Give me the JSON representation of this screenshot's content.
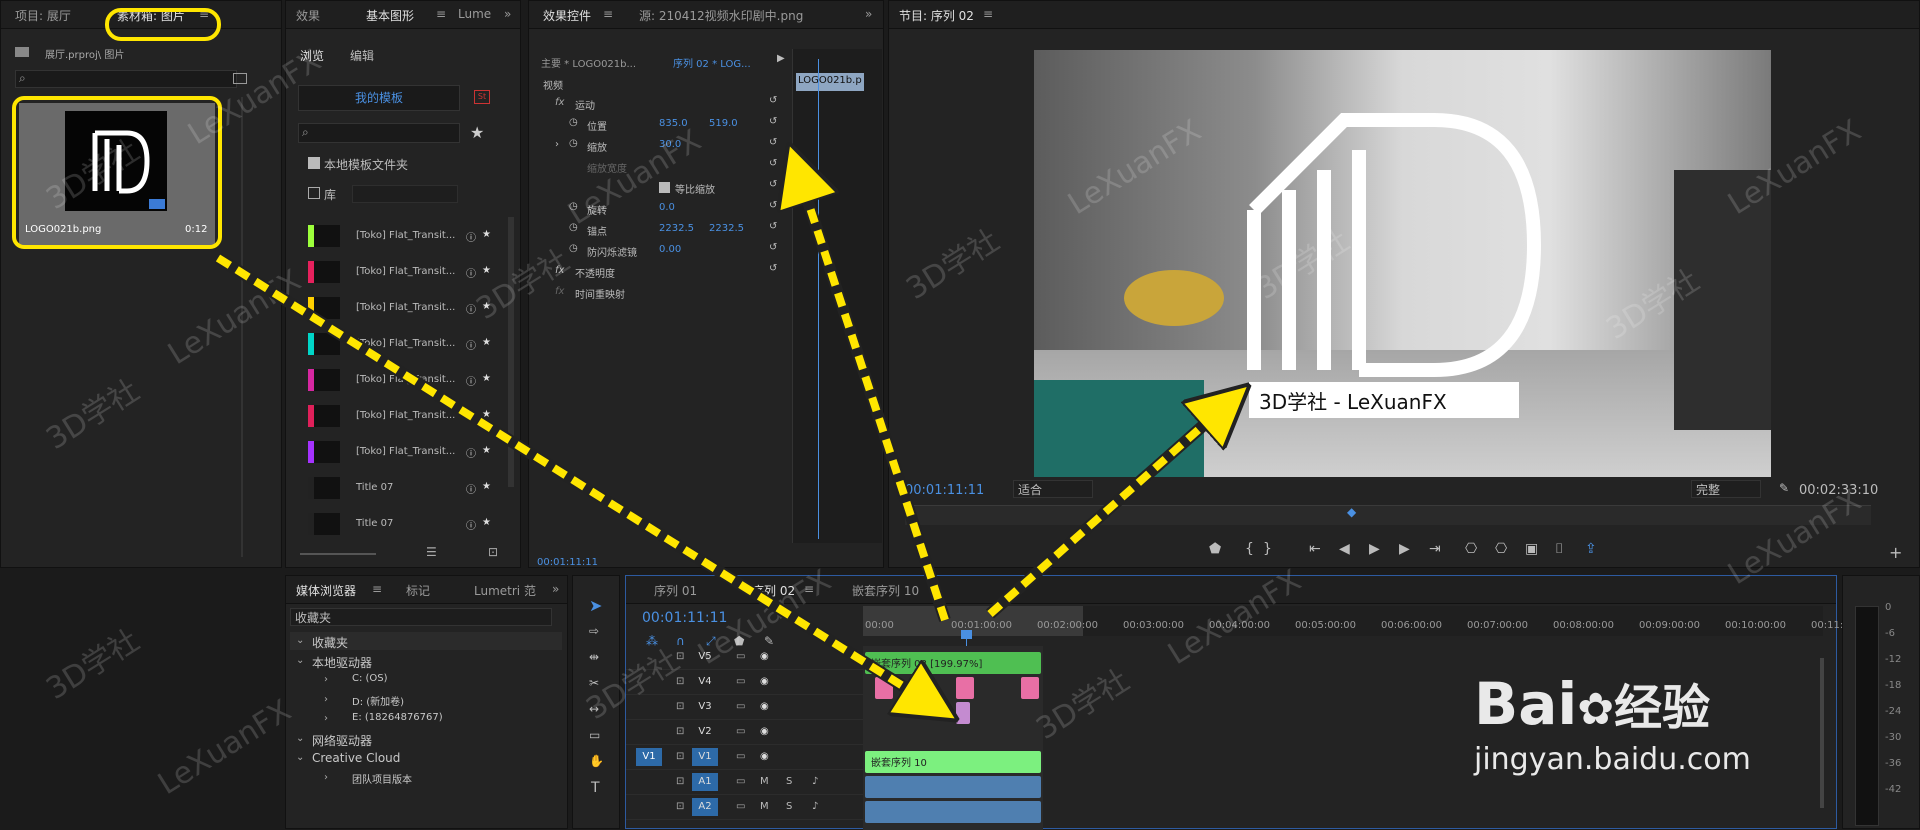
{
  "project_panel": {
    "tab_project": "项目: 展厅",
    "tab_bin": "素材箱: 图片",
    "path": "展厅.prproj\\ 图片",
    "thumb_name": "LOGO021b.png",
    "thumb_duration": "0:12"
  },
  "graphics_panel": {
    "tab_effects": "效果",
    "tab_basic": "基本图形",
    "tab_lumetri": "Lume",
    "subtab_browse": "浏览",
    "subtab_edit": "编辑",
    "my_templates": "我的模板",
    "local_folder": "本地模板文件夹",
    "library": "库",
    "items": [
      {
        "label": "[Toko] Flat_Transit...",
        "color": "#9cff3b"
      },
      {
        "label": "[Toko] Flat_Transit...",
        "color": "#e6215d"
      },
      {
        "label": "[Toko] Flat_Transit...",
        "color": "#ffd000"
      },
      {
        "label": "[Toko] Flat_Transit...",
        "color": "#00d6c8"
      },
      {
        "label": "[Toko] Flat_Transit...",
        "color": "#d627a1"
      },
      {
        "label": "[Toko] Flat_Transit...",
        "color": "#e0205a"
      },
      {
        "label": "[Toko] Flat_Transit...",
        "color": "#a532ff"
      },
      {
        "label": "Title 07",
        "color": "#222222"
      },
      {
        "label": "Title 07",
        "color": "#222222"
      }
    ]
  },
  "effect_controls": {
    "tab_effect": "效果控件",
    "tab_source": "源: 210412视频水印剧中.png",
    "master": "主要 * LOGO021b...",
    "sequence": "序列 02 * LOG...",
    "section_video": "视频",
    "motion": "运动",
    "position_label": "位置",
    "position_x": "835.0",
    "position_y": "519.0",
    "scale_label": "缩放",
    "scale_value": "30.0",
    "scale_width_label": "缩放宽度",
    "uniform_scale": "等比缩放",
    "rotation_label": "旋转",
    "rotation_value": "0.0",
    "anchor_label": "锚点",
    "anchor_x": "2232.5",
    "anchor_y": "2232.5",
    "flicker_label": "防闪烁滤镜",
    "flicker_value": "0.00",
    "opacity": "不透明度",
    "time_remap": "时间重映射",
    "mini_clip": "LOGO021b.p",
    "timecode": "00:01:11:11"
  },
  "program_monitor": {
    "title": "节目: 序列 02",
    "timecode_left": "00:01:11:11",
    "fit": "适合",
    "quality": "完整",
    "timecode_right": "00:02:33:10",
    "logo_text": "3D学社 - LeXuanFX"
  },
  "media_browser": {
    "tab_media": "媒体浏览器",
    "tab_markers": "标记",
    "tab_lumetri": "Lumetri 范",
    "dropdown": "收藏夹",
    "tree": [
      {
        "label": "收藏夹",
        "indent": 0
      },
      {
        "label": "本地驱动器",
        "indent": 0
      },
      {
        "label": "C: (OS)",
        "indent": 2
      },
      {
        "label": "D: (新加卷)",
        "indent": 2
      },
      {
        "label": "E: (18264876767)",
        "indent": 2
      },
      {
        "label": "网络驱动器",
        "indent": 0
      },
      {
        "label": "Creative Cloud",
        "indent": 0
      },
      {
        "label": "团队项目版本",
        "indent": 2
      }
    ]
  },
  "timeline": {
    "tab1": "序列 01",
    "tab2": "序列 02",
    "tab3": "嵌套序列 10",
    "timecode": "00:01:11:11",
    "ruler": [
      "00:00",
      "00:01:00:00",
      "00:02:00:00",
      "00:03:00:00",
      "00:04:00:00",
      "00:05:00:00",
      "00:06:00:00",
      "00:07:00:00",
      "00:08:00:00",
      "00:09:00:00",
      "00:10:00:00",
      "00:11:0"
    ],
    "tracks": [
      "V5",
      "V4",
      "V3",
      "V2",
      "V1",
      "A1",
      "A2"
    ],
    "v1_src": "V1",
    "clip_v5": "嵌套序列 08 [199.97%]",
    "clip_v1": "嵌套序列 10",
    "track_m": "M",
    "track_s": "S"
  },
  "meter": [
    "0",
    "-6",
    "-12",
    "-18",
    "-24",
    "-30",
    "-36",
    "-42"
  ],
  "watermarks": {
    "lexuan": "LeXuanFX",
    "xueshe": "3D学社"
  },
  "baidu": {
    "logo": "Bai",
    "logo_cn": "经验",
    "url": "jingyan.baidu.com"
  }
}
